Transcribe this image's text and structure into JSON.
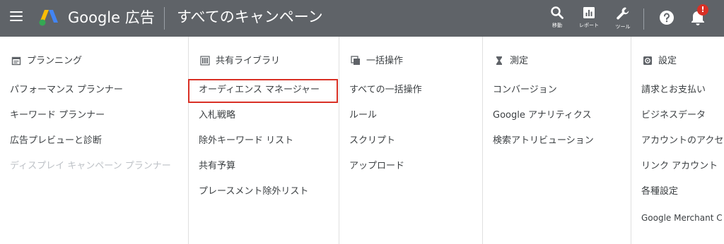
{
  "header": {
    "brand": "Google 広告",
    "title": "すべてのキャンペーン",
    "tools": [
      {
        "icon": "search-icon",
        "label": "移動"
      },
      {
        "icon": "reports-icon",
        "label": "レポート"
      },
      {
        "icon": "wrench-icon",
        "label": "ツール"
      }
    ],
    "notification_badge": "!"
  },
  "columns": [
    {
      "icon": "calendar-icon",
      "heading": "プランニング",
      "items": [
        "パフォーマンス プランナー",
        "キーワード プランナー",
        "広告プレビューと診断",
        "ディスプレイ キャンペーン プランナー"
      ]
    },
    {
      "icon": "library-icon",
      "heading": "共有ライブラリ",
      "items": [
        "オーディエンス マネージャー",
        "入札戦略",
        "除外キーワード リスト",
        "共有予算",
        "プレースメント除外リスト"
      ]
    },
    {
      "icon": "bulk-actions-icon",
      "heading": "一括操作",
      "items": [
        "すべての一括操作",
        "ルール",
        "スクリプト",
        "アップロード"
      ]
    },
    {
      "icon": "hourglass-icon",
      "heading": "測定",
      "items": [
        "コンバージョン",
        "Google アナリティクス",
        "検索アトリビューション"
      ]
    },
    {
      "icon": "settings-icon",
      "heading": "設定",
      "items": [
        "請求とお支払い",
        "ビジネスデータ",
        "アカウントのアクセ",
        "リンク アカウント",
        "各種設定",
        "Google Merchant C"
      ]
    }
  ],
  "colors": {
    "topbar": "#5f6368",
    "highlight": "#d93025",
    "disabled_text": "#bdc1c6"
  }
}
